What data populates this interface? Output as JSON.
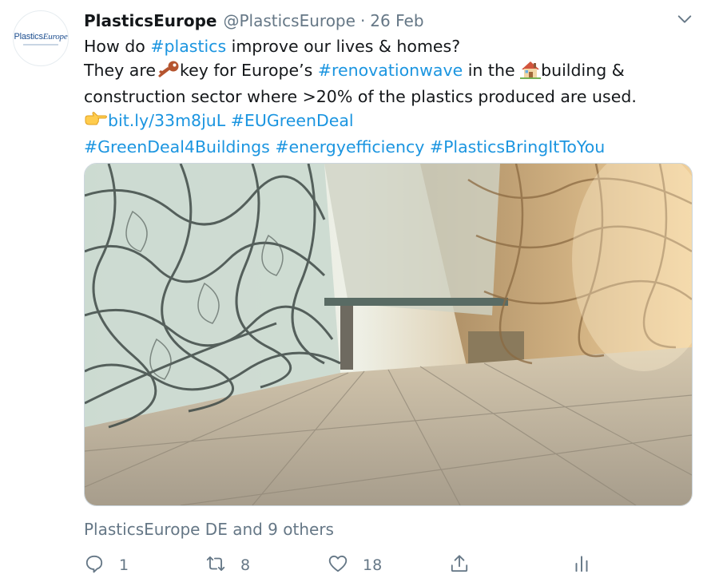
{
  "author": {
    "name": "PlasticsEurope",
    "handle": "@PlasticsEurope",
    "separator": "·",
    "date": "26 Feb",
    "avatar_logo_plain": "Plastics",
    "avatar_logo_italic": "Europe"
  },
  "tweet": {
    "l1_a": "How do ",
    "l1_link": "#plastics",
    "l1_b": " improve our lives & homes?",
    "l2_a": "They are",
    "l2_b": "key for Europe’s ",
    "l2_link": "#renovationwave",
    "l2_c": " in the ",
    "l2_d": "building &",
    "l3": "construction sector where >20% of the plastics produced are used.",
    "l4_link1": "bit.ly/33m8juL",
    "l4_link2": "#EUGreenDeal",
    "l5_link1": "#GreenDeal4Buildings",
    "l5_link2": "#energyefficiency",
    "l5_link3": "#PlasticsBringItToYou"
  },
  "emojis": {
    "key": "key-emoji",
    "house": "house-emoji",
    "pointing": "pointing-right-emoji"
  },
  "liked_by": "PlasticsEurope DE and 9 others",
  "actions": {
    "reply_count": "1",
    "retweet_count": "8",
    "like_count": "18"
  },
  "icons": [
    "caret-down-icon",
    "reply-icon",
    "retweet-icon",
    "like-icon",
    "share-icon",
    "analytics-icon"
  ],
  "colors": {
    "link": "#1b95e0",
    "secondary": "#657786",
    "text": "#14171a",
    "border": "#ccd6dd"
  }
}
